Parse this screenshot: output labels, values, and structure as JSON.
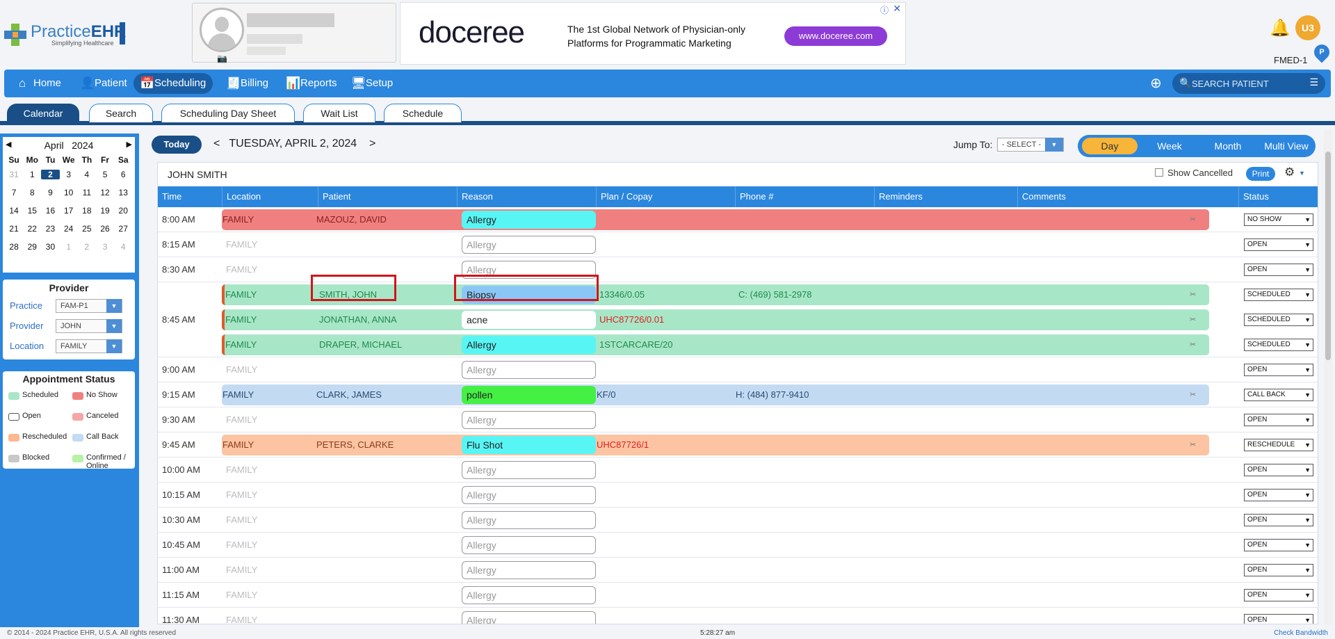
{
  "header": {
    "logo_text_light": "Practice",
    "logo_text_bold": "EHR",
    "logo_tagline": "Simplifying Healthcare",
    "ad": {
      "logo": "doceree",
      "text_line1": "The 1st Global Network of Physician-only",
      "text_line2": "Platforms for Programmatic Marketing",
      "button": "www.doceree.com"
    },
    "user_initials": "U3",
    "facility": "FMED-1",
    "pin_letter": "P"
  },
  "nav": {
    "items": [
      {
        "label": "Home",
        "icon": "home-icon"
      },
      {
        "label": "Patient",
        "icon": "person-icon"
      },
      {
        "label": "Scheduling",
        "icon": "calendar-icon"
      },
      {
        "label": "Billing",
        "icon": "invoice-icon"
      },
      {
        "label": "Reports",
        "icon": "chart-icon"
      },
      {
        "label": "Setup",
        "icon": "monitor-gear-icon"
      }
    ],
    "active": "Scheduling",
    "search_placeholder": "SEARCH PATIENT"
  },
  "subtabs": {
    "items": [
      "Calendar",
      "Search",
      "Scheduling Day Sheet",
      "Wait List",
      "Schedule"
    ],
    "active": "Calendar"
  },
  "calendar": {
    "month": "April",
    "year": "2024",
    "dow": [
      "Su",
      "Mo",
      "Tu",
      "We",
      "Th",
      "Fr",
      "Sa"
    ],
    "weeks": [
      [
        "31",
        "1",
        "2",
        "3",
        "4",
        "5",
        "6"
      ],
      [
        "7",
        "8",
        "9",
        "10",
        "11",
        "12",
        "13"
      ],
      [
        "14",
        "15",
        "16",
        "17",
        "18",
        "19",
        "20"
      ],
      [
        "21",
        "22",
        "23",
        "24",
        "25",
        "26",
        "27"
      ],
      [
        "28",
        "29",
        "30",
        "1",
        "2",
        "3",
        "4"
      ]
    ],
    "selected": "2"
  },
  "provider_panel": {
    "title": "Provider",
    "practice_label": "Practice",
    "practice_value": "FAM-P1",
    "provider_label": "Provider",
    "provider_value": "JOHN",
    "location_label": "Location",
    "location_value": "FAMILY"
  },
  "appointment_status": {
    "title": "Appointment Status",
    "items": [
      {
        "label": "Scheduled",
        "color": "#a8e6c8"
      },
      {
        "label": "No Show",
        "color": "#f08080"
      },
      {
        "label": "Open",
        "color": "#ffffff"
      },
      {
        "label": "Canceled",
        "color": "#f7a5a5"
      },
      {
        "label": "Rescheduled",
        "color": "#fcb890"
      },
      {
        "label": "Call Back",
        "color": "#c3dbf2"
      },
      {
        "label": "Blocked",
        "color": "#c8c8c8"
      },
      {
        "label": "Confirmed /\nOnline",
        "color": "#b6f2a6"
      }
    ]
  },
  "toolbar": {
    "today": "Today",
    "prev": "<",
    "date": "TUESDAY, APRIL 2, 2024",
    "next": ">",
    "jump_label": "Jump To:",
    "jump_value": "- SELECT -",
    "views": [
      "Day",
      "Week",
      "Month",
      "Multi View"
    ],
    "active_view": "Day"
  },
  "schedule": {
    "provider_name": "JOHN SMITH",
    "show_cancelled": "Show Cancelled",
    "print": "Print",
    "columns": [
      "Time",
      "Location",
      "Patient",
      "Reason",
      "Plan / Copay",
      "Phone #",
      "Reminders",
      "Comments",
      "Status"
    ],
    "rows": [
      {
        "time": "8:00 AM",
        "kind": "ns",
        "location": "FAMILY",
        "patient": "MAZOUZ, DAVID",
        "reason": "Allergy",
        "reason_style": "cyan",
        "plan": "",
        "phone": "",
        "status": "NO SHOW"
      },
      {
        "time": "8:15 AM",
        "kind": "open",
        "location": "FAMILY",
        "reason": "Allergy",
        "status": "OPEN"
      },
      {
        "time": "8:30 AM",
        "kind": "open",
        "location": "FAMILY",
        "reason": "Allergy",
        "status": "OPEN"
      },
      {
        "time": "",
        "kind": "sc",
        "location": "FAMILY",
        "patient": "SMITH, JOHN",
        "reason": "Biopsy",
        "reason_style": "blue",
        "plan": "13346/0.05",
        "plan_red": false,
        "phone": "C: (469) 581-2978",
        "status": "SCHEDULED"
      },
      {
        "time": "8:45 AM",
        "kind": "sc",
        "location": "FAMILY",
        "patient": "JONATHAN, ANNA",
        "reason": "acne",
        "reason_style": "white",
        "plan": "UHC87726/0.01",
        "plan_red": true,
        "phone": "",
        "status": "SCHEDULED"
      },
      {
        "time": "",
        "kind": "sc",
        "location": "FAMILY",
        "patient": "DRAPER, MICHAEL",
        "reason": "Allergy",
        "reason_style": "cyan",
        "plan": "1STCARCARE/20",
        "plan_red": false,
        "phone": "",
        "status": "SCHEDULED"
      },
      {
        "time": "9:00 AM",
        "kind": "open",
        "location": "FAMILY",
        "reason": "Allergy",
        "status": "OPEN"
      },
      {
        "time": "9:15 AM",
        "kind": "cb",
        "location": "FAMILY",
        "patient": "CLARK, JAMES",
        "reason": "pollen",
        "reason_style": "green",
        "plan": "KF/0",
        "plan_red": false,
        "phone": "H: (484) 877-9410",
        "status": "CALL BACK"
      },
      {
        "time": "9:30 AM",
        "kind": "open",
        "location": "FAMILY",
        "reason": "Allergy",
        "status": "OPEN"
      },
      {
        "time": "9:45 AM",
        "kind": "rs",
        "location": "FAMILY",
        "patient": "PETERS, CLARKE",
        "reason": "Flu Shot",
        "reason_style": "cyan",
        "plan": "UHC87726/1",
        "plan_red": true,
        "phone": "",
        "status": "RESCHEDULE"
      },
      {
        "time": "10:00 AM",
        "kind": "open",
        "location": "FAMILY",
        "reason": "Allergy",
        "status": "OPEN"
      },
      {
        "time": "10:15 AM",
        "kind": "open",
        "location": "FAMILY",
        "reason": "Allergy",
        "status": "OPEN"
      },
      {
        "time": "10:30 AM",
        "kind": "open",
        "location": "FAMILY",
        "reason": "Allergy",
        "status": "OPEN"
      },
      {
        "time": "10:45 AM",
        "kind": "open",
        "location": "FAMILY",
        "reason": "Allergy",
        "status": "OPEN"
      },
      {
        "time": "11:00 AM",
        "kind": "open",
        "location": "FAMILY",
        "reason": "Allergy",
        "status": "OPEN"
      },
      {
        "time": "11:15 AM",
        "kind": "open",
        "location": "FAMILY",
        "reason": "Allergy",
        "status": "OPEN"
      },
      {
        "time": "11:30 AM",
        "kind": "open",
        "location": "FAMILY",
        "reason": "Allergy",
        "status": "OPEN"
      }
    ]
  },
  "footer": {
    "copyright": "© 2014 - 2024 Practice EHR, U.S.A. All rights reserved",
    "clock": "5:28:27 am",
    "bandwidth": "Check Bandwidth"
  }
}
